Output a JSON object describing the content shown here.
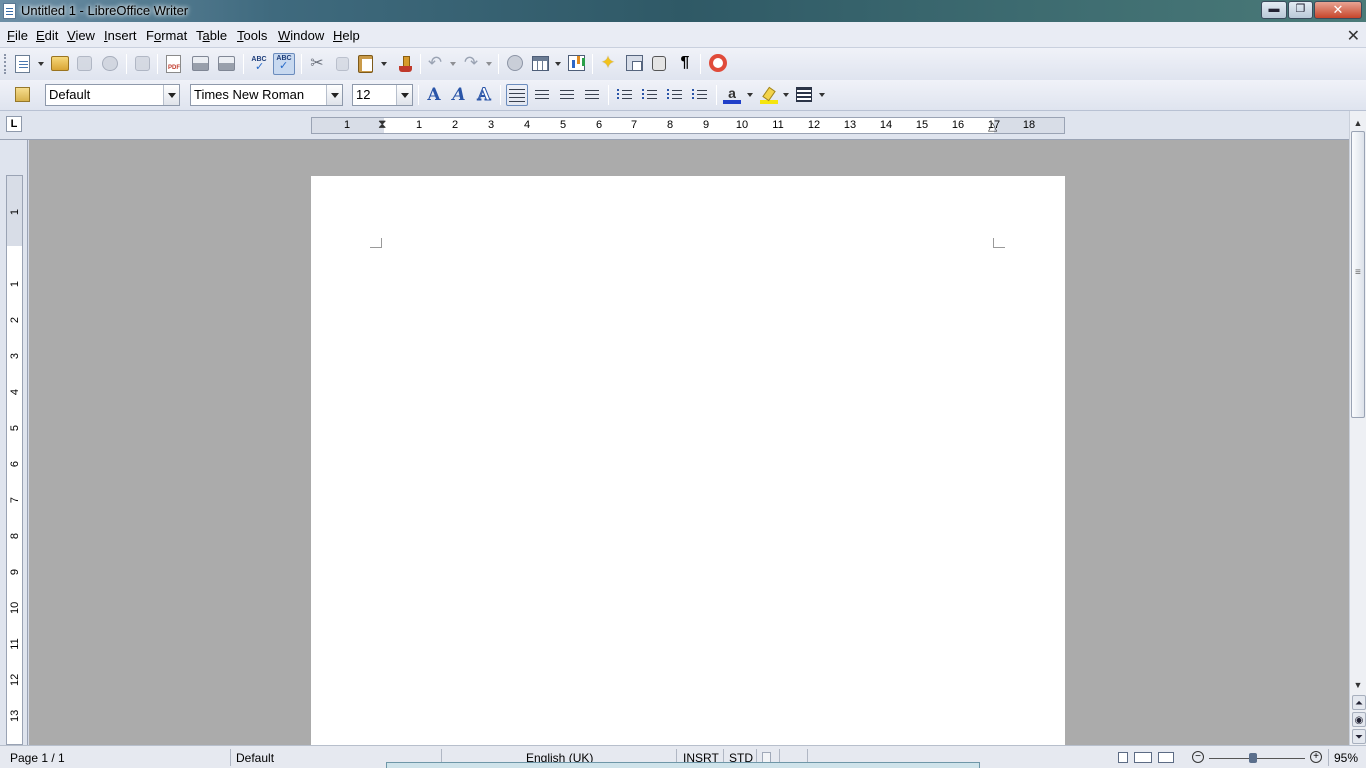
{
  "window": {
    "title": "Untitled 1 - LibreOffice Writer",
    "minimize": "▬",
    "maximize": "❐",
    "close": "✕"
  },
  "menu": [
    {
      "acc": "F",
      "rest": "ile"
    },
    {
      "acc": "E",
      "rest": "dit"
    },
    {
      "acc": "V",
      "rest": "iew"
    },
    {
      "acc": "I",
      "rest": "nsert"
    },
    {
      "pre": "F",
      "acc": "o",
      "rest": "rmat"
    },
    {
      "pre": "T",
      "acc": "a",
      "rest": "ble"
    },
    {
      "acc": "T",
      "rest": "ools"
    },
    {
      "acc": "W",
      "rest": "indow"
    },
    {
      "acc": "H",
      "rest": "elp"
    }
  ],
  "doc_close": "✕",
  "formatting": {
    "paragraph_style": "Default",
    "font_name": "Times New Roman",
    "font_size": "12",
    "bold": "A",
    "italic": "A",
    "outline": "A",
    "font_color_letter": "a"
  },
  "toolbar_icons": {
    "spellcheck": "ABC",
    "autospell": "ABC",
    "scissors": "✂",
    "undo": "↶",
    "redo": "↷",
    "pilcrow": "¶",
    "star": "✦"
  },
  "ruler": {
    "tab_selector": "L",
    "h_labels": [
      "1",
      "1",
      "2",
      "3",
      "4",
      "5",
      "6",
      "7",
      "8",
      "9",
      "10",
      "11",
      "12",
      "13",
      "14",
      "15",
      "16",
      "17",
      "18"
    ],
    "v_labels": [
      "1",
      "1",
      "2",
      "3",
      "4",
      "5",
      "6",
      "7",
      "8",
      "9",
      "10",
      "11",
      "12",
      "13"
    ]
  },
  "scroll": {
    "up": "▲",
    "down": "▼",
    "prev": "⏶",
    "nav": "◉",
    "next": "⏷"
  },
  "status": {
    "page": "Page 1 / 1",
    "page_style": "Default",
    "language": "English (UK)",
    "insert_mode": "INSRT",
    "selection_mode": "STD",
    "zoom_minus": "−",
    "zoom_plus": "+",
    "zoom": "95%"
  }
}
